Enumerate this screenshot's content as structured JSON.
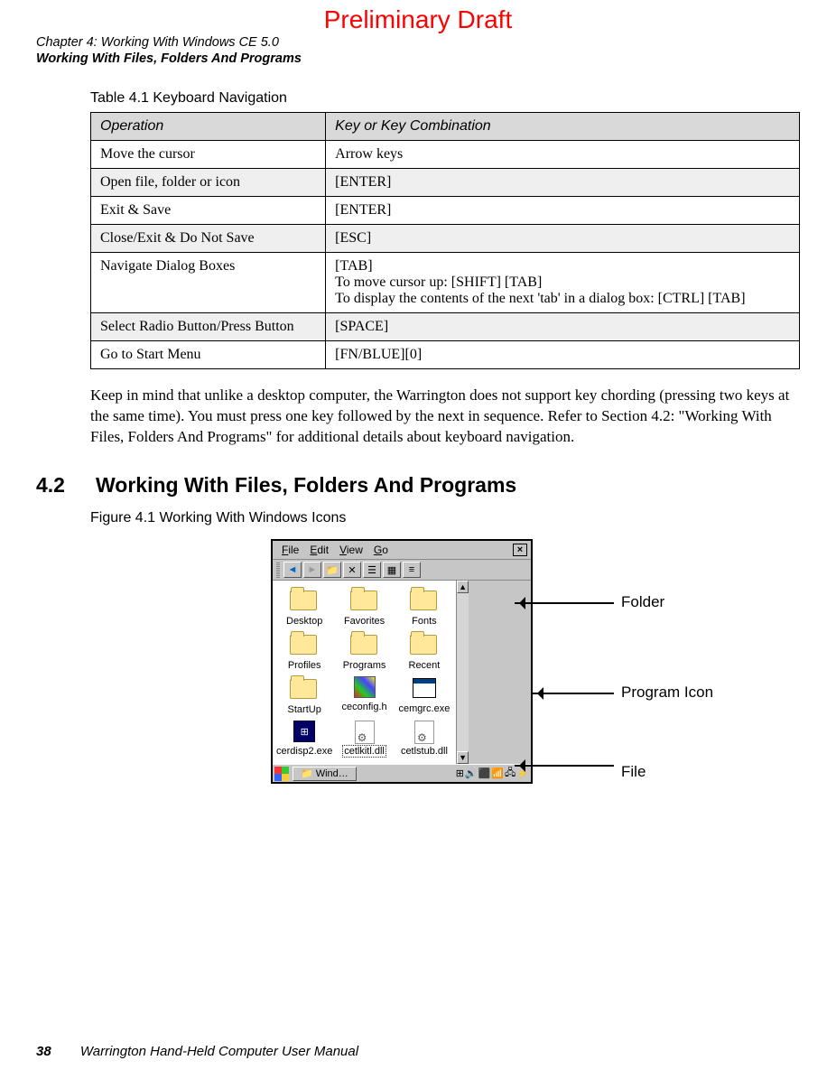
{
  "watermark": "Preliminary Draft",
  "header": {
    "line1": "Chapter 4:  Working With Windows CE 5.0",
    "line2": "Working With Files, Folders And Programs"
  },
  "table_caption": "Table 4.1    Keyboard Navigation",
  "table": {
    "head": {
      "op": "Operation",
      "key": "Key or Key Combination"
    },
    "rows": [
      {
        "op": "Move the cursor",
        "key": "Arrow keys"
      },
      {
        "op": "Open file, folder or icon",
        "key": "[ENTER]"
      },
      {
        "op": "Exit & Save",
        "key": "[ENTER]"
      },
      {
        "op": "Close/Exit & Do Not Save",
        "key": "[ESC]"
      },
      {
        "op": "Navigate Dialog Boxes",
        "key": "[TAB]\nTo move cursor up: [SHIFT] [TAB]\nTo display the contents of the next 'tab' in a dialog box: [CTRL] [TAB]"
      },
      {
        "op": "Select Radio Button/Press Button",
        "key": "[SPACE]"
      },
      {
        "op": "Go to Start Menu",
        "key": "[FN/BLUE][0]"
      }
    ]
  },
  "body_para": "Keep in mind that unlike a desktop computer, the Warrington does not support key chording (pressing two keys at the same time). You must press one key followed by the next in sequence. Refer to Section 4.2: \"Working With Files, Folders And Programs\" for additional details about keyboard navigation.",
  "section": {
    "num": "4.2",
    "title": "Working With Files, Folders And Programs"
  },
  "figure_caption": "Figure 4.1  Working With Windows Icons",
  "explorer": {
    "menus": {
      "file": "File",
      "edit": "Edit",
      "view": "View",
      "go": "Go"
    },
    "close": "×",
    "items": [
      {
        "label": "Desktop",
        "type": "folder"
      },
      {
        "label": "Favorites",
        "type": "folder"
      },
      {
        "label": "Fonts",
        "type": "folder"
      },
      {
        "label": "Profiles",
        "type": "folder"
      },
      {
        "label": "Programs",
        "type": "folder"
      },
      {
        "label": "Recent",
        "type": "folder"
      },
      {
        "label": "StartUp",
        "type": "folder"
      },
      {
        "label": "ceconfig.h",
        "type": "cfg"
      },
      {
        "label": "cemgrc.exe",
        "type": "prog"
      },
      {
        "label": "cerdisp2.exe",
        "type": "exe"
      },
      {
        "label": "cetlkitl.dll",
        "type": "dll",
        "selected": true
      },
      {
        "label": "cetlstub.dll",
        "type": "dll"
      }
    ],
    "task_label": "Wind…"
  },
  "annotations": {
    "folder": "Folder",
    "program": "Program Icon",
    "file": "File"
  },
  "footer": {
    "page": "38",
    "text": "Warrington Hand-Held Computer User Manual"
  }
}
